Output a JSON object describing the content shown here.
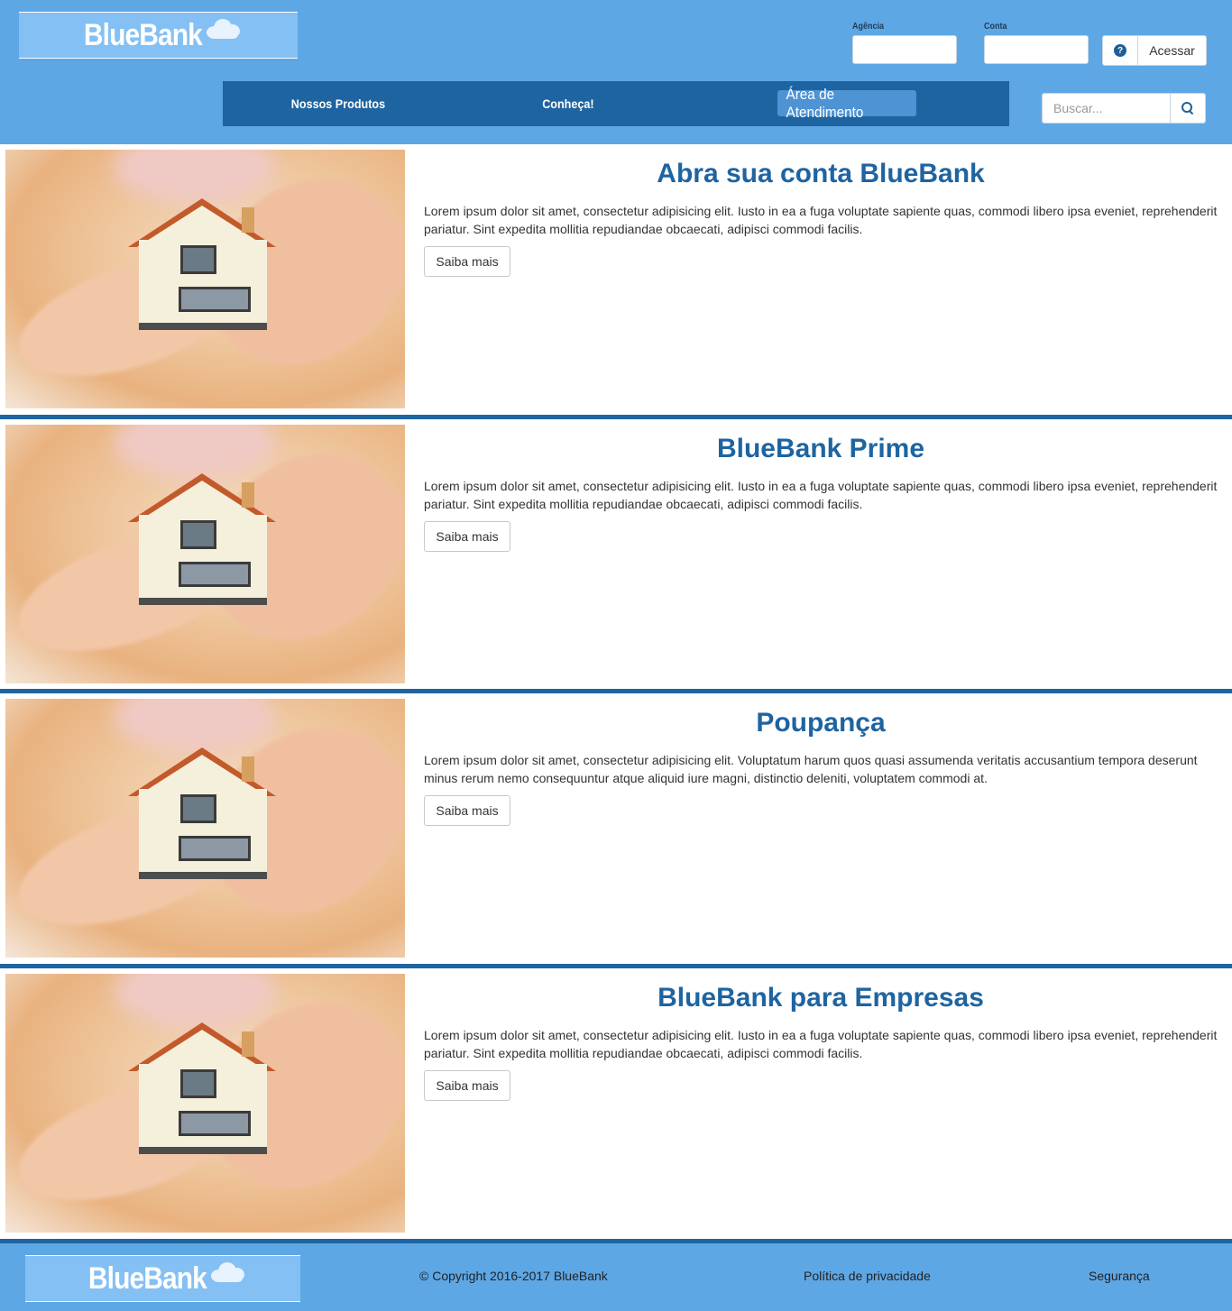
{
  "brand": {
    "name": "BlueBank",
    "primary_color": "#1e64a1",
    "header_color": "#5ea7e5",
    "logo_bg": "#84c0f3"
  },
  "login": {
    "agency_label": "Agência",
    "account_label": "Conta",
    "help_icon": "question-circle-icon",
    "submit_label": "Acessar"
  },
  "nav": {
    "items": [
      {
        "label": "Nossos Produtos"
      },
      {
        "label": "Conheça!"
      },
      {
        "label": "Área de Atendimento",
        "active": true
      }
    ]
  },
  "search": {
    "placeholder": "Buscar...",
    "icon": "search-icon"
  },
  "sections": [
    {
      "title": "Abra sua conta BlueBank",
      "text": "Lorem ipsum dolor sit amet, consectetur adipisicing elit. Iusto in ea a fuga voluptate sapiente quas, commodi libero ipsa eveniet, reprehenderit pariatur. Sint expedita mollitia repudiandae obcaecati, adipisci commodi facilis.",
      "button": "Saiba mais"
    },
    {
      "title": "BlueBank Prime",
      "text": "Lorem ipsum dolor sit amet, consectetur adipisicing elit. Iusto in ea a fuga voluptate sapiente quas, commodi libero ipsa eveniet, reprehenderit pariatur. Sint expedita mollitia repudiandae obcaecati, adipisci commodi facilis.",
      "button": "Saiba mais"
    },
    {
      "title": "Poupança",
      "text": "Lorem ipsum dolor sit amet, consectetur adipisicing elit. Voluptatum harum quos quasi assumenda veritatis accusantium tempora deserunt minus rerum nemo consequuntur atque aliquid iure magni, distinctio deleniti, voluptatem commodi at.",
      "button": "Saiba mais"
    },
    {
      "title": "BlueBank para Empresas",
      "text": "Lorem ipsum dolor sit amet, consectetur adipisicing elit. Iusto in ea a fuga voluptate sapiente quas, commodi libero ipsa eveniet, reprehenderit pariatur. Sint expedita mollitia repudiandae obcaecati, adipisci commodi facilis.",
      "button": "Saiba mais"
    }
  ],
  "footer": {
    "copyright": "© Copyright 2016-2017 BlueBank",
    "privacy": "Política de privacidade",
    "security": "Segurança"
  }
}
